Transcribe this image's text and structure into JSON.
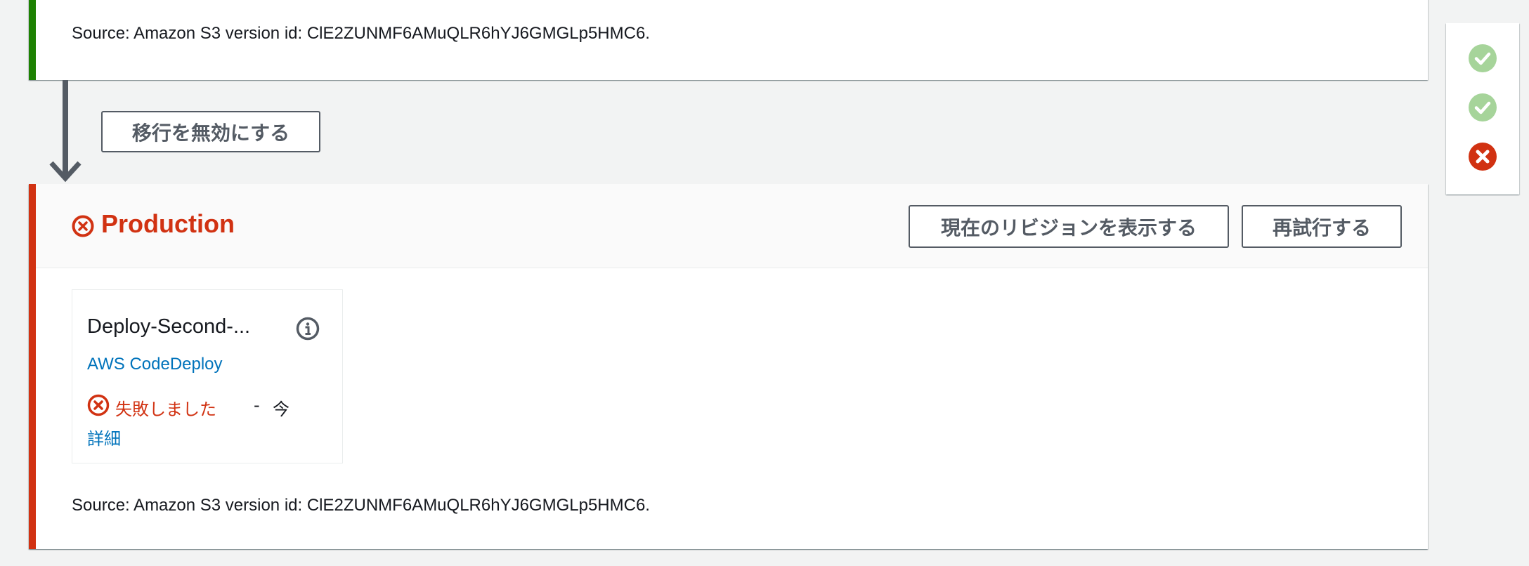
{
  "previous_stage": {
    "source_text": "Source: Amazon S3 version id: ClE2ZUNMF6AMuQLR6hYJ6GMGLp5HMC6."
  },
  "transition": {
    "disable_label": "移行を無効にする"
  },
  "production_stage": {
    "title": "Production",
    "status_icon": "error-circle-icon",
    "view_revision_label": "現在のリビジョンを表示する",
    "retry_label": "再試行する",
    "action": {
      "name": "Deploy-Second-...",
      "provider": "AWS CodeDeploy",
      "status": "失敗しました",
      "separator": "-",
      "time": "今",
      "details_label": "詳細"
    },
    "source_text": "Source: Amazon S3 version id: ClE2ZUNMF6AMuQLR6hYJ6GMGLp5HMC6."
  },
  "stage_status_panel": {
    "icons": [
      "check-circle-icon",
      "check-circle-icon",
      "error-circle-icon"
    ]
  },
  "colors": {
    "success": "#1d8102",
    "success_light": "#a6d49a",
    "error": "#d13212",
    "link": "#0073bb",
    "button_border": "#545b64"
  }
}
